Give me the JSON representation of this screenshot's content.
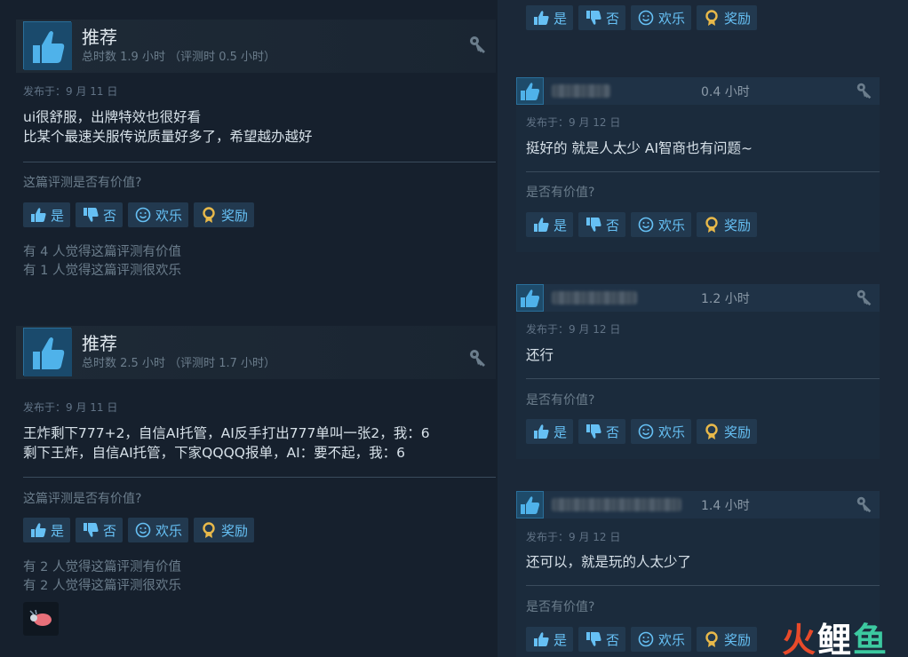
{
  "review1": {
    "title": "推荐",
    "hours": "总时数 1.9 小时 （评测时 0.5 小时）",
    "posted": "发布于：9 月 11 日",
    "body_line1": "ui很舒服，出牌特效也很好看",
    "body_line2": "比某个最速关服传说质量好多了，希望越办越好",
    "question": "这篇评测是否有价值?",
    "btn_yes": "是",
    "btn_no": "否",
    "btn_fun": "欢乐",
    "btn_award": "奖励",
    "stat1": "有 4 人觉得这篇评测有价值",
    "stat2": "有 1 人觉得这篇评测很欢乐"
  },
  "review2": {
    "title": "推荐",
    "hours": "总时数 2.5 小时 （评测时 1.7 小时）",
    "posted": "发布于：9 月 11 日",
    "body_line1": "王炸剩下777+2，自信AI托管，AI反手打出777单叫一张2，我：6",
    "body_line2": "剩下王炸，自信AI托管，下家QQQQ报单，AI：要不起，我：6",
    "question": "这篇评测是否有价值?",
    "btn_yes": "是",
    "btn_no": "否",
    "btn_fun": "欢乐",
    "btn_award": "奖励",
    "stat1": "有 2 人觉得这篇评测有价值",
    "stat2": "有 2 人觉得这篇评测很欢乐"
  },
  "right_top_buttons": {
    "btn_yes": "是",
    "btn_no": "否",
    "btn_fun": "欢乐",
    "btn_award": "奖励"
  },
  "right_reviews": [
    {
      "hours": "0.4 小时",
      "posted": "发布于：9 月 12 日",
      "body": "挺好的 就是人太少 AI智商也有问题~",
      "question": "是否有价值?",
      "btn_yes": "是",
      "btn_no": "否",
      "btn_fun": "欢乐",
      "btn_award": "奖励"
    },
    {
      "hours": "1.2 小时",
      "posted": "发布于：9 月 12 日",
      "body": "还行",
      "question": "是否有价值?",
      "btn_yes": "是",
      "btn_no": "否",
      "btn_fun": "欢乐",
      "btn_award": "奖励"
    },
    {
      "hours": "1.4 小时",
      "posted": "发布于：9 月 12 日",
      "body": "还可以，就是玩的人太少了",
      "question": "是否有价值?",
      "btn_yes": "是",
      "btn_no": "否",
      "btn_fun": "欢乐",
      "btn_award": "奖励"
    }
  ],
  "watermark": {
    "c1": "火",
    "c2": "鲤",
    "c3": "鱼"
  },
  "colors": {
    "accent": "#66c0f4",
    "background": "#1b2838",
    "panel": "#16202d"
  },
  "icons": [
    "thumbs-up-icon",
    "thumbs-down-icon",
    "smiley-icon",
    "award-icon",
    "key-icon"
  ]
}
